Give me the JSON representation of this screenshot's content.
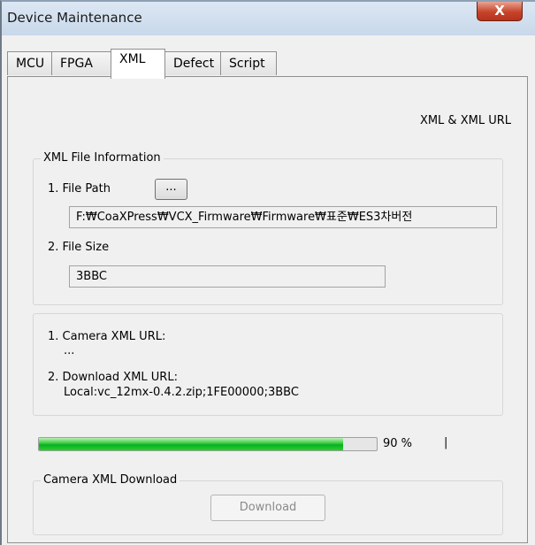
{
  "window": {
    "title": "Device Maintenance",
    "close_glyph": "X"
  },
  "tabs": [
    {
      "label": "MCU",
      "active": false
    },
    {
      "label": "FPGA",
      "active": false
    },
    {
      "label": "XML",
      "active": true
    },
    {
      "label": "Defect",
      "active": false
    },
    {
      "label": "Script",
      "active": false
    }
  ],
  "xml_tab": {
    "header_label": "XML & XML URL",
    "file_info": {
      "group_title": "XML File Information",
      "file_path_label": "1. File Path",
      "browse_button": "...",
      "file_path_value": "F:₩CoaXPress₩VCX_Firmware₩Firmware₩표준₩ES3차버전",
      "file_size_label": "2. File Size",
      "file_size_value": "3BBC"
    },
    "urls": {
      "camera_xml_url_label": "1. Camera XML URL:",
      "camera_xml_url_value": "...",
      "download_xml_url_label": "2. Download XML URL:",
      "download_xml_url_value": "Local:vc_12mx-0.4.2.zip;1FE00000;3BBC"
    },
    "progress": {
      "fraction": 0.9,
      "percent_text": "90 %",
      "cursor_glyph": "|"
    },
    "download_group": {
      "group_title": "Camera XML Download",
      "download_button": "Download"
    }
  },
  "colors": {
    "progress_green": "#06b025",
    "close_red": "#c7442b"
  }
}
